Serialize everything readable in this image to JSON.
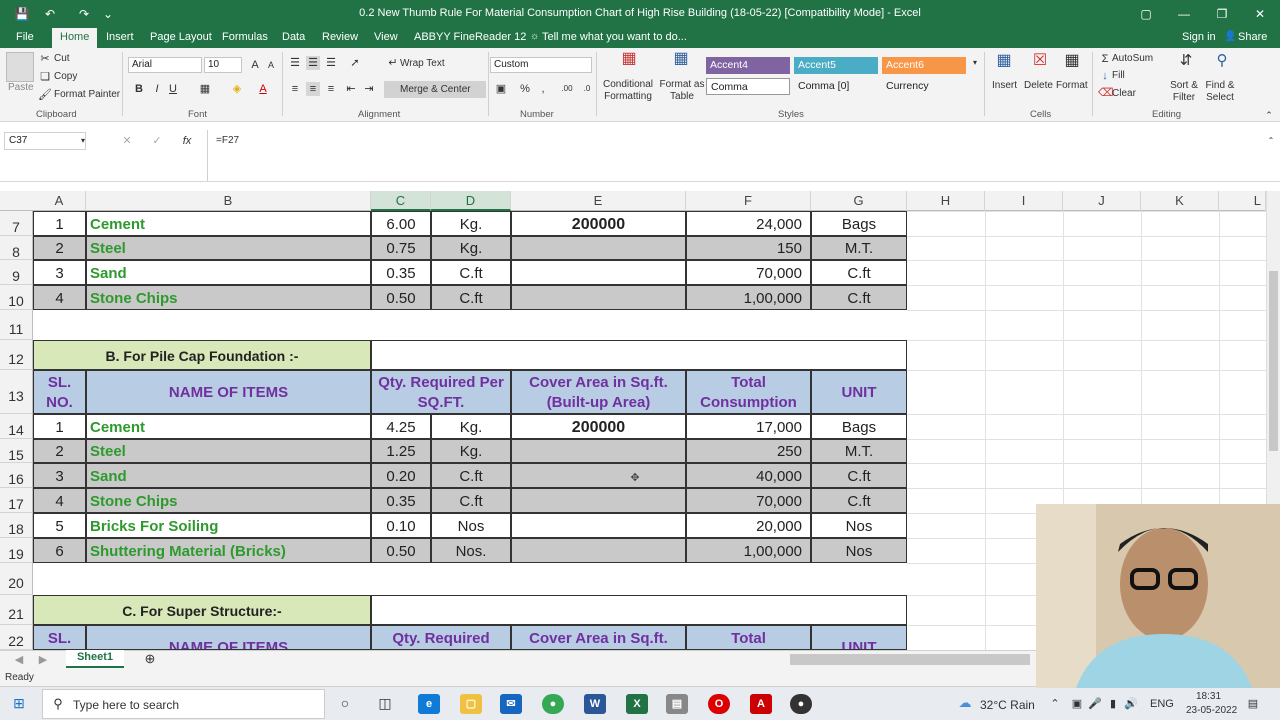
{
  "titlebar": {
    "title": "0.2 New Thumb Rule For Material Consumption Chart  of High Rise Building (18-05-22)  [Compatibility Mode] - Excel"
  },
  "tabs": [
    "File",
    "Home",
    "Insert",
    "Page Layout",
    "Formulas",
    "Data",
    "Review",
    "View",
    "ABBYY FineReader 12"
  ],
  "tell_me": "Tell me what you want to do...",
  "signin": "Sign in",
  "share": "Share",
  "ribbon": {
    "clipboard": {
      "paste": "Paste",
      "cut": "Cut",
      "copy": "Copy",
      "format_painter": "Format Painter",
      "label": "Clipboard"
    },
    "font": {
      "name": "Arial",
      "size": "10",
      "label": "Font"
    },
    "alignment": {
      "wrap": "Wrap Text",
      "merge": "Merge & Center",
      "label": "Alignment"
    },
    "number": {
      "format": "Custom",
      "label": "Number"
    },
    "styles": {
      "cond": "Conditional Formatting",
      "table": "Format as Table",
      "accent4": "Accent4",
      "accent5": "Accent5",
      "accent6": "Accent6",
      "comma": "Comma",
      "comma0": "Comma [0]",
      "currency": "Currency",
      "label": "Styles"
    },
    "cells": {
      "insert": "Insert",
      "delete": "Delete",
      "format": "Format",
      "label": "Cells"
    },
    "editing": {
      "autosum": "AutoSum",
      "fill": "Fill",
      "clear": "Clear",
      "sort": "Sort & Filter",
      "find": "Find & Select",
      "label": "Editing"
    }
  },
  "formula": {
    "name_box": "C37",
    "value": "=F27"
  },
  "columns": [
    "A",
    "B",
    "C",
    "D",
    "E",
    "F",
    "G",
    "H",
    "I",
    "J",
    "K",
    "L"
  ],
  "rows_a": [
    {
      "row": "7",
      "sl": "1",
      "name": "Cement",
      "qty": "6.00",
      "unit1": "Kg.",
      "area": "200000",
      "total": "24,000",
      "unit": "Bags"
    },
    {
      "row": "8",
      "sl": "2",
      "name": "Steel",
      "qty": "0.75",
      "unit1": "Kg.",
      "area": "",
      "total": "150",
      "unit": "M.T."
    },
    {
      "row": "9",
      "sl": "3",
      "name": "Sand",
      "qty": "0.35",
      "unit1": "C.ft",
      "area": "",
      "total": "70,000",
      "unit": "C.ft"
    },
    {
      "row": "10",
      "sl": "4",
      "name": "Stone Chips",
      "qty": "0.50",
      "unit1": "C.ft",
      "area": "",
      "total": "1,00,000",
      "unit": "C.ft"
    }
  ],
  "section_b": "B. For Pile Cap Foundation :-",
  "header": {
    "sl": "SL. NO.",
    "name": "NAME OF ITEMS",
    "qty": "Qty. Required Per SQ.FT.",
    "area": "Cover Area in Sq.ft. (Built-up Area)",
    "total": "Total Consumption",
    "unit": "UNIT"
  },
  "rows_b": [
    {
      "row": "14",
      "sl": "1",
      "name": "Cement",
      "qty": "4.25",
      "unit1": "Kg.",
      "area": "200000",
      "total": "17,000",
      "unit": "Bags"
    },
    {
      "row": "15",
      "sl": "2",
      "name": "Steel",
      "qty": "1.25",
      "unit1": "Kg.",
      "area": "",
      "total": "250",
      "unit": "M.T."
    },
    {
      "row": "16",
      "sl": "3",
      "name": "Sand",
      "qty": "0.20",
      "unit1": "C.ft",
      "area": "",
      "total": "40,000",
      "unit": "C.ft"
    },
    {
      "row": "17",
      "sl": "4",
      "name": "Stone Chips",
      "qty": "0.35",
      "unit1": "C.ft",
      "area": "",
      "total": "70,000",
      "unit": "C.ft"
    },
    {
      "row": "18",
      "sl": "5",
      "name": "Bricks For Soiling",
      "qty": "0.10",
      "unit1": "Nos",
      "area": "",
      "total": "20,000",
      "unit": "Nos"
    },
    {
      "row": "19",
      "sl": "6",
      "name": "Shuttering Material (Bricks)",
      "qty": "0.50",
      "unit1": "Nos.",
      "area": "",
      "total": "1,00,000",
      "unit": "Nos"
    }
  ],
  "section_c": "C. For Super Structure:-",
  "row_labels": {
    "r11": "11",
    "r12": "12",
    "r13": "13",
    "r20": "20",
    "r21": "21",
    "r22": "22"
  },
  "partial_header": {
    "sl": "SL.",
    "name": "NAME OF ITEMS",
    "qty": "Qty. Required",
    "area": "Cover Area in Sq.ft.",
    "total": "Total",
    "unit": "UNIT"
  },
  "sheet_tab": "Sheet1",
  "status": "Ready",
  "taskbar": {
    "search": "Type here to search",
    "weather": "32°C  Rain",
    "lang": "ENG",
    "time": "18:31",
    "date": "23-05-2022"
  }
}
